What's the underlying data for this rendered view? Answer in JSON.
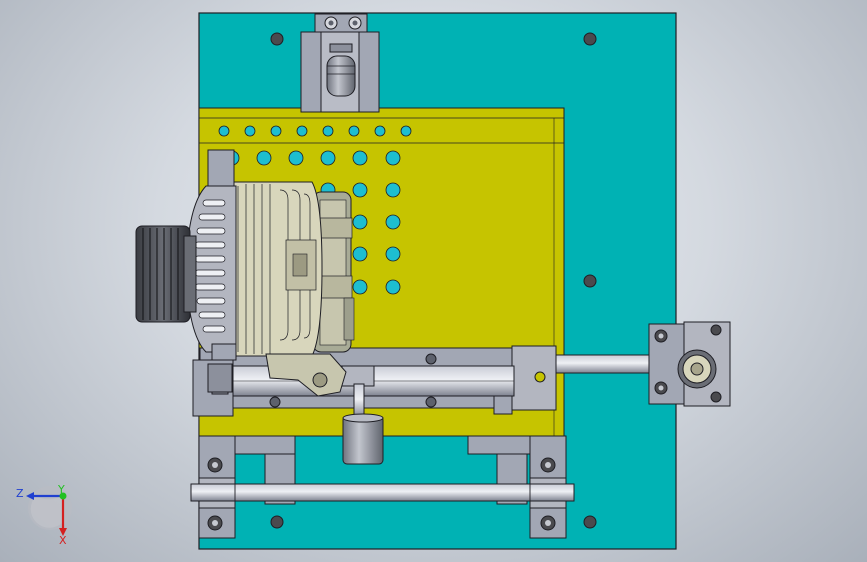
{
  "viewport": {
    "background": [
      "#e9edf2",
      "#a9b0ba"
    ]
  },
  "colors": {
    "base_plate": "#00b2b4",
    "yellow_plate": "#c6c400",
    "metal_gray": "#a2a7b4",
    "metal_dark": "#5d616c",
    "alternator_body": "#d8d6bc",
    "outline": "#1e1e24",
    "hole_dark": "#4a4a4e",
    "hole_cyan": "#1dbed0"
  },
  "triad": {
    "x_label": "X",
    "y_label": "Y",
    "z_label": "Z",
    "x_color": "#d42020",
    "y_color": "#22c022",
    "z_color": "#2040d0"
  },
  "parts": [
    "base-plate",
    "yellow-mounting-plate",
    "alternator",
    "alternator-pulley",
    "top-clamp-block",
    "right-bearing-block",
    "guide-rail-bottom",
    "slide-rail-center",
    "cylinder-actuator"
  ]
}
